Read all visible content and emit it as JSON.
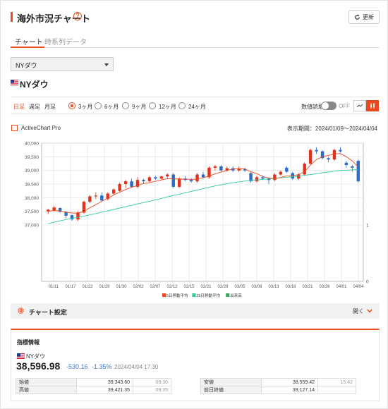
{
  "header": {
    "title": "海外市況チャート",
    "help_icon": "question-circle-icon",
    "refresh_label": "更新"
  },
  "tabs": [
    {
      "label": "チャート",
      "active": true
    },
    {
      "label": "時系列データ",
      "active": false
    }
  ],
  "index_select": {
    "value": "NYダウ"
  },
  "index_name": "NYダウ",
  "periodicity": [
    {
      "label": "日足",
      "active": true
    },
    {
      "label": "週足",
      "active": false
    },
    {
      "label": "月足",
      "active": false
    }
  ],
  "ranges": [
    {
      "label": "3ヶ月",
      "selected": true
    },
    {
      "label": "6ヶ月",
      "selected": false
    },
    {
      "label": "9ヶ月",
      "selected": false
    },
    {
      "label": "12ヶ月",
      "selected": false
    },
    {
      "label": "24ヶ月",
      "selected": false
    }
  ],
  "numeric_readout": {
    "label": "数値読取",
    "state": "OFF"
  },
  "chart_modes": [
    {
      "icon": "line-chart-icon",
      "active": false
    },
    {
      "icon": "candlestick-icon",
      "active": true
    }
  ],
  "activechart_label": "ActiveChart Pro",
  "display_period": "表示期間：2024/01/09〜2024/04/04",
  "chart_data": {
    "type": "candlestick",
    "y_ticks": [
      "40,000",
      "39,500",
      "39,000",
      "38,500",
      "38,000",
      "37,500",
      "37,000"
    ],
    "y_values": [
      40000,
      39500,
      39000,
      38500,
      38000,
      37500,
      37000
    ],
    "ylim": [
      37000,
      40000
    ],
    "right_ticks": [
      "1",
      "0"
    ],
    "x_ticks": [
      "01/11",
      "01/17",
      "01/22",
      "01/29",
      "01/30",
      "02/02",
      "02/07",
      "02/12",
      "02/15",
      "02/21",
      "02/29",
      "03/05",
      "03/08",
      "03/13",
      "03/18",
      "03/21",
      "03/26",
      "04/01",
      "04/04"
    ],
    "candles": [
      {
        "o": 37500,
        "h": 37600,
        "l": 37400,
        "c": 37560
      },
      {
        "o": 37540,
        "h": 37700,
        "l": 37500,
        "c": 37640
      },
      {
        "o": 37620,
        "h": 37650,
        "l": 37450,
        "c": 37480
      },
      {
        "o": 37480,
        "h": 37500,
        "l": 37250,
        "c": 37340
      },
      {
        "o": 37360,
        "h": 37380,
        "l": 37150,
        "c": 37200
      },
      {
        "o": 37200,
        "h": 37500,
        "l": 37150,
        "c": 37460
      },
      {
        "o": 37450,
        "h": 37900,
        "l": 37420,
        "c": 37850
      },
      {
        "o": 37850,
        "h": 38100,
        "l": 37800,
        "c": 38050
      },
      {
        "o": 38050,
        "h": 38200,
        "l": 37950,
        "c": 38080
      },
      {
        "o": 38080,
        "h": 38200,
        "l": 37850,
        "c": 37900
      },
      {
        "o": 37950,
        "h": 38200,
        "l": 37900,
        "c": 38150
      },
      {
        "o": 38150,
        "h": 38350,
        "l": 38100,
        "c": 38300
      },
      {
        "o": 38250,
        "h": 38550,
        "l": 38200,
        "c": 38500
      },
      {
        "o": 38500,
        "h": 38650,
        "l": 38350,
        "c": 38600
      },
      {
        "o": 38600,
        "h": 38700,
        "l": 38350,
        "c": 38400
      },
      {
        "o": 38400,
        "h": 38750,
        "l": 38350,
        "c": 38650
      },
      {
        "o": 38650,
        "h": 38700,
        "l": 38500,
        "c": 38600
      },
      {
        "o": 38600,
        "h": 38800,
        "l": 38550,
        "c": 38750
      },
      {
        "o": 38750,
        "h": 38800,
        "l": 38650,
        "c": 38700
      },
      {
        "o": 38700,
        "h": 38800,
        "l": 38650,
        "c": 38780
      },
      {
        "o": 38780,
        "h": 38900,
        "l": 38700,
        "c": 38850
      },
      {
        "o": 38850,
        "h": 38900,
        "l": 38350,
        "c": 38400
      },
      {
        "o": 38400,
        "h": 38750,
        "l": 38350,
        "c": 38700
      },
      {
        "o": 38700,
        "h": 38800,
        "l": 38600,
        "c": 38650
      },
      {
        "o": 38650,
        "h": 38720,
        "l": 38550,
        "c": 38600
      },
      {
        "o": 38600,
        "h": 38900,
        "l": 38550,
        "c": 38850
      },
      {
        "o": 38850,
        "h": 38950,
        "l": 38700,
        "c": 38750
      },
      {
        "o": 38750,
        "h": 39150,
        "l": 38700,
        "c": 39100
      },
      {
        "o": 39100,
        "h": 39200,
        "l": 39000,
        "c": 39150
      },
      {
        "o": 39150,
        "h": 39200,
        "l": 38950,
        "c": 39000
      },
      {
        "o": 39000,
        "h": 39150,
        "l": 38950,
        "c": 39080
      },
      {
        "o": 39080,
        "h": 39150,
        "l": 38950,
        "c": 39000
      },
      {
        "o": 39000,
        "h": 39150,
        "l": 38950,
        "c": 39050
      },
      {
        "o": 39050,
        "h": 39100,
        "l": 38950,
        "c": 39000
      },
      {
        "o": 38900,
        "h": 38950,
        "l": 38550,
        "c": 38600
      },
      {
        "o": 38600,
        "h": 38800,
        "l": 38550,
        "c": 38750
      },
      {
        "o": 38750,
        "h": 38800,
        "l": 38650,
        "c": 38700
      },
      {
        "o": 38700,
        "h": 38750,
        "l": 38500,
        "c": 38650
      },
      {
        "o": 38650,
        "h": 38900,
        "l": 38600,
        "c": 38850
      },
      {
        "o": 38850,
        "h": 39000,
        "l": 38800,
        "c": 38950
      },
      {
        "o": 39100,
        "h": 39150,
        "l": 38900,
        "c": 38950
      },
      {
        "o": 38900,
        "h": 38950,
        "l": 38650,
        "c": 38700
      },
      {
        "o": 38700,
        "h": 38900,
        "l": 38650,
        "c": 38850
      },
      {
        "o": 38850,
        "h": 39300,
        "l": 38800,
        "c": 39250
      },
      {
        "o": 39250,
        "h": 39800,
        "l": 39200,
        "c": 39750
      },
      {
        "o": 39750,
        "h": 39850,
        "l": 39600,
        "c": 39700
      },
      {
        "o": 39700,
        "h": 39750,
        "l": 39400,
        "c": 39450
      },
      {
        "o": 39450,
        "h": 39500,
        "l": 39300,
        "c": 39400
      },
      {
        "o": 39400,
        "h": 39800,
        "l": 39350,
        "c": 39750
      },
      {
        "o": 39750,
        "h": 39850,
        "l": 39650,
        "c": 39700
      },
      {
        "o": 39280,
        "h": 39350,
        "l": 39100,
        "c": 39200
      },
      {
        "o": 39150,
        "h": 39200,
        "l": 38950,
        "c": 39100
      },
      {
        "o": 39350,
        "h": 39400,
        "l": 38550,
        "c": 38600
      }
    ],
    "ma5": [
      37500,
      37530,
      37510,
      37470,
      37440,
      37430,
      37500,
      37630,
      37740,
      37870,
      37980,
      38100,
      38200,
      38300,
      38380,
      38450,
      38520,
      38550,
      38600,
      38650,
      38700,
      38690,
      38680,
      38680,
      38670,
      38680,
      38730,
      38800,
      38870,
      38940,
      39000,
      39050,
      39070,
      39050,
      38950,
      38880,
      38780,
      38720,
      38700,
      38740,
      38800,
      38800,
      38850,
      38950,
      39200,
      39400,
      39500,
      39550,
      39600,
      39620,
      39500,
      39350,
      39120
    ],
    "ma25": [
      37050,
      37100,
      37150,
      37200,
      37240,
      37280,
      37320,
      37370,
      37420,
      37470,
      37520,
      37570,
      37620,
      37670,
      37720,
      37770,
      37820,
      37870,
      37920,
      37970,
      38030,
      38080,
      38130,
      38180,
      38230,
      38280,
      38330,
      38380,
      38430,
      38470,
      38510,
      38550,
      38580,
      38610,
      38630,
      38650,
      38670,
      38690,
      38710,
      38730,
      38750,
      38770,
      38790,
      38820,
      38850,
      38880,
      38910,
      38940,
      38970,
      39000,
      39010,
      39020,
      39030
    ],
    "legend": [
      {
        "label": "5日移動平均",
        "color": "#e8491d"
      },
      {
        "label": "25日移動平均",
        "color": "#32c9a0"
      },
      {
        "label": "出来高",
        "color": "#3aa655"
      }
    ],
    "colors": {
      "up": "#e0301e",
      "down": "#2a6cc7",
      "ma5": "#e8491d",
      "ma25": "#32c9a0"
    }
  },
  "chart_settings": {
    "label": "チャート設定",
    "open_label": "開く"
  },
  "info": {
    "title": "指標情報",
    "index_name": "NYダウ",
    "price": "38,596.98",
    "change": "-530.16",
    "change_pct": "-1.35%",
    "time": "2024/04/04 17:30",
    "left_rows": [
      {
        "k": "始値",
        "v": "39,343.60",
        "t": "09:30"
      },
      {
        "k": "高値",
        "v": "39,421.35",
        "t": "09:35"
      }
    ],
    "right_rows": [
      {
        "k": "安値",
        "v": "38,559.42",
        "t": "15:42"
      },
      {
        "k": "前日終値",
        "v": "39,127.14",
        "t": ""
      }
    ]
  }
}
